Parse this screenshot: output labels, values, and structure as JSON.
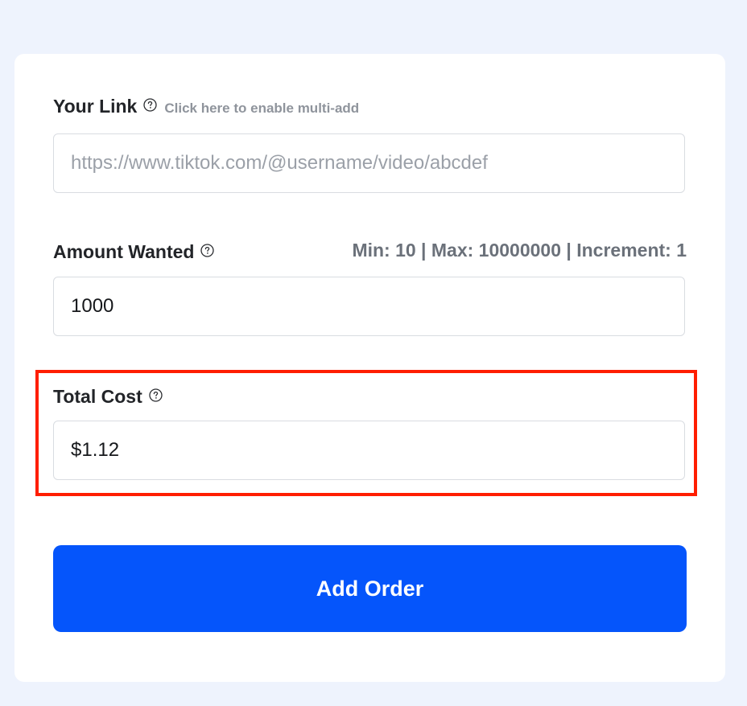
{
  "link_section": {
    "label": "Your Link",
    "help_icon": "question-circle-icon",
    "multi_add_hint": "Click here to enable multi-add",
    "placeholder": "https://www.tiktok.com/@username/video/abcdef",
    "value": ""
  },
  "amount_section": {
    "label": "Amount Wanted",
    "help_icon": "question-circle-icon",
    "limits": "Min: 10 | Max: 10000000 | Increment: 1",
    "value": "1000"
  },
  "cost_section": {
    "label": "Total Cost",
    "help_icon": "question-circle-icon",
    "value": "$1.12"
  },
  "submit": {
    "label": "Add Order"
  },
  "colors": {
    "page_background": "#eef3fd",
    "card_background": "#ffffff",
    "button_primary": "#0555fb",
    "highlight_border": "#ff1e00"
  }
}
